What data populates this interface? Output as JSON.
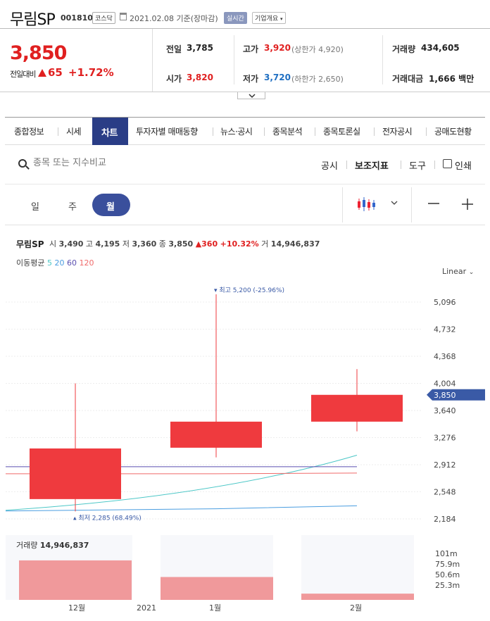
{
  "header": {
    "title": "무림SP",
    "code": "001810",
    "market_badge": "코스닥",
    "date": "2021.02.08",
    "basis": "기준(장마감)",
    "realtime_badge": "실시간",
    "company_badge": "기업개요"
  },
  "price": {
    "current": "3,850",
    "change_label": "전일대비",
    "change": "65",
    "change_pct": "+1.72%"
  },
  "stats": {
    "prev_label": "전일",
    "prev": "3,785",
    "high_label": "고가",
    "high": "3,920",
    "upper_limit": "(상한가 4,920)",
    "volume_label": "거래량",
    "volume": "434,605",
    "open_label": "시가",
    "open": "3,820",
    "low_label": "저가",
    "low": "3,720",
    "lower_limit": "(하한가 2,650)",
    "amount_label": "거래대금",
    "amount": "1,666",
    "amount_unit": "백만"
  },
  "tabs": [
    "종합정보",
    "시세",
    "차트",
    "투자자별 매매동향",
    "뉴스·공시",
    "종목분석",
    "종목토론실",
    "전자공시",
    "공매도현황"
  ],
  "search": {
    "placeholder": "종목 또는 지수비교"
  },
  "tools": {
    "disclosure": "공시",
    "indicators": "보조지표",
    "tool": "도구",
    "print": "인쇄"
  },
  "periods": {
    "day": "일",
    "week": "주",
    "month": "월"
  },
  "chart_info": {
    "name": "무림SP",
    "open_l": "시",
    "open": "3,490",
    "high_l": "고",
    "high": "4,195",
    "low_l": "저",
    "low": "3,360",
    "close_l": "종",
    "close": "3,850",
    "chg": "360",
    "chg_pct": "+10.32%",
    "vol_l": "거",
    "vol": "14,946,837"
  },
  "ma": {
    "label": "이동평균",
    "p5": "5",
    "p20": "20",
    "p60": "60",
    "p120": "120",
    "c5": "#4cc7c7",
    "c20": "#4a9de0",
    "c60": "#5a4fb0",
    "c120": "#f06a6a"
  },
  "scale_label": "Linear",
  "colors": {
    "up": "#ef3a3e",
    "accent": "#2a3d86",
    "price_tag": "#3a5aa6"
  },
  "chart_data": {
    "type": "candlestick",
    "categories": [
      "12월",
      "1월",
      "2월"
    ],
    "candles": [
      {
        "open": 2450,
        "high": 4004,
        "low": 2285,
        "close": 3130
      },
      {
        "open": 3140,
        "high": 5200,
        "low": 3010,
        "close": 3490
      },
      {
        "open": 3490,
        "high": 4195,
        "low": 3360,
        "close": 3850
      }
    ],
    "yticks": [
      "5,096",
      "4,732",
      "4,368",
      "4,004",
      "3,640",
      "3,276",
      "2,912",
      "2,548",
      "2,184"
    ],
    "ytick_values": [
      5096,
      4732,
      4368,
      4004,
      3640,
      3276,
      2912,
      2548,
      2184
    ],
    "max_label": "최고 5,200 (-25.96%)",
    "min_label": "최저 2,285 (68.49%)",
    "current_tag": "3,850",
    "ma_lines": {
      "ma5": [
        2300,
        2580,
        3040
      ],
      "ma20": [
        2290,
        2320,
        2360
      ],
      "ma60": [
        2885,
        2885,
        2885
      ],
      "ma120": [
        2790,
        2790,
        2800
      ]
    },
    "volume_label": "거래량",
    "volume_value": "14,946,837",
    "volume_values": [
      95,
      55,
      15
    ],
    "volume_ticks": [
      "101m",
      "75.9m",
      "50.6m",
      "25.3m"
    ],
    "year_label": "2021"
  }
}
